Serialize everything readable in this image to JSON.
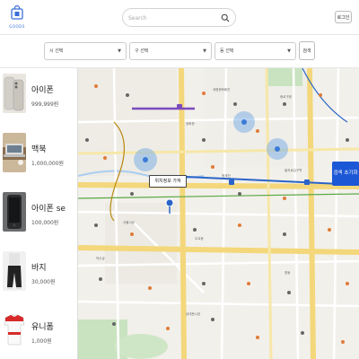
{
  "header": {
    "logo_text": "GOODS",
    "search_placeholder": "Search",
    "login_label": "로그인"
  },
  "filters": {
    "city": "시 선택",
    "district": "구 선택",
    "dong": "동 선택",
    "search_button": "검색"
  },
  "listings": [
    {
      "title": "아이폰",
      "price": "999,999원"
    },
    {
      "title": "맥북",
      "price": "1,000,000원"
    },
    {
      "title": "아이폰 se",
      "price": "100,000원"
    },
    {
      "title": "바지",
      "price": "30,000원"
    },
    {
      "title": "유니폼",
      "price": "1,000원"
    }
  ],
  "map": {
    "tooltip": "위치정보 가져",
    "reset_button": "검색 초기화",
    "labels": [
      "세종문화회관",
      "종로구청",
      "광화문",
      "청계천",
      "을지로입구역",
      "서울시청",
      "덕수궁",
      "명동",
      "남대문시장",
      "무교동"
    ]
  },
  "colors": {
    "accent": "#1c57d6",
    "road": "#f3d77a",
    "water": "#a9cdf0",
    "park": "#c9e3c0"
  }
}
